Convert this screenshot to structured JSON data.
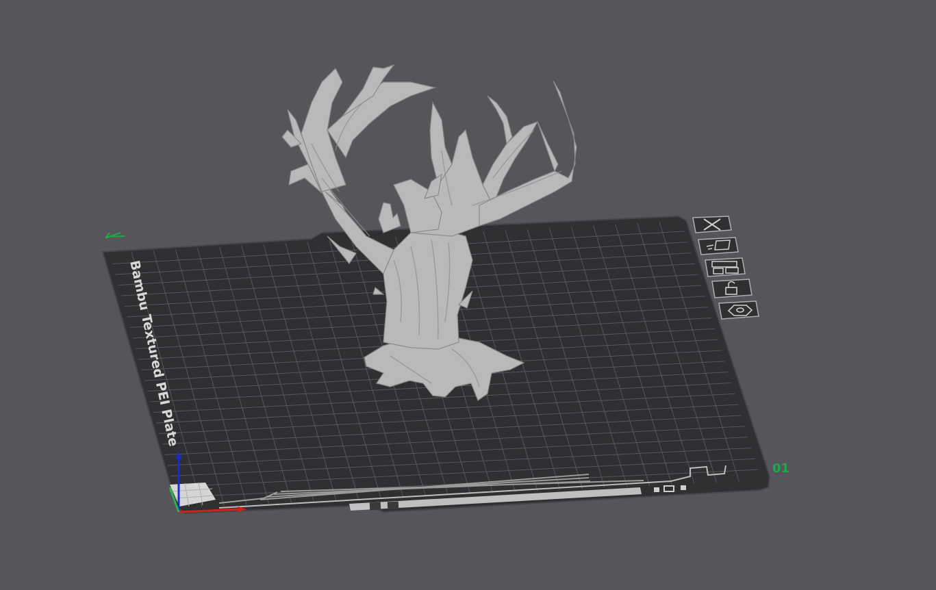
{
  "viewport": {
    "background_color": "#55555a",
    "plate_color": "#303033",
    "grid_color": "#5a5a5e",
    "model_color": "#b9b9b9"
  },
  "plate": {
    "label": "Bambu Textured PEI Plate",
    "plate_number": "01",
    "number_color": "#1fa84a"
  },
  "plate_toolbar": {
    "items": [
      {
        "icon": "close-icon",
        "name": "remove-plate-button"
      },
      {
        "icon": "pick-plate-icon",
        "name": "select-plate-button"
      },
      {
        "icon": "arrange-icon",
        "name": "arrange-plate-button"
      },
      {
        "icon": "unlock-icon",
        "name": "lock-plate-button"
      },
      {
        "icon": "plate-settings-icon",
        "name": "plate-settings-button"
      }
    ]
  },
  "axes": {
    "x_color": "#d0211c",
    "y_color": "#2bb24c",
    "z_color": "#1b2fbf"
  }
}
